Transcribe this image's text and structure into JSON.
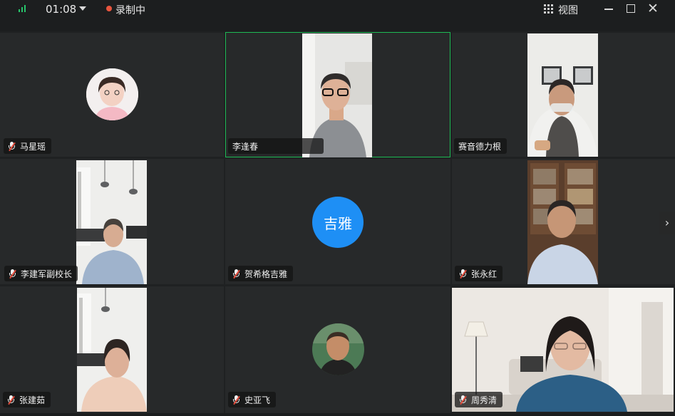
{
  "topbar": {
    "time": "01:08",
    "recording_label": "录制中",
    "view_label": "视图",
    "close_glyph": "✕"
  },
  "participants": [
    {
      "name": "马星瑶",
      "muted": true,
      "display": "avatar-photo"
    },
    {
      "name": "李逢春",
      "muted": false,
      "display": "video",
      "speaking": true
    },
    {
      "name": "赛音德力根",
      "muted": false,
      "display": "video"
    },
    {
      "name": "李建军副校长",
      "muted": true,
      "display": "video"
    },
    {
      "name": "贺希格吉雅",
      "muted": true,
      "display": "text-avatar",
      "avatar_text": "吉雅"
    },
    {
      "name": "张永红",
      "muted": true,
      "display": "video"
    },
    {
      "name": "张建茹",
      "muted": true,
      "display": "video"
    },
    {
      "name": "史亚飞",
      "muted": true,
      "display": "avatar-photo"
    },
    {
      "name": "周秀清",
      "muted": true,
      "display": "video"
    }
  ],
  "colors": {
    "background": "#1f2122",
    "tile": "#27292a",
    "speaking_border": "#1db954",
    "recording_dot": "#e8553e",
    "signal": "#27c36a",
    "text_avatar": "#1e8ff5",
    "muted_slash": "#e24a3a"
  },
  "icons": {
    "signal": "signal-bars-icon",
    "dropdown": "chevron-down-icon",
    "recording": "record-dot-icon",
    "view": "grid-view-icon",
    "minimize": "minimize-icon",
    "maximize": "maximize-icon",
    "close": "close-icon",
    "mic_muted": "mic-muted-icon",
    "next_page": "chevron-right-icon"
  },
  "next_page_glyph": "›"
}
